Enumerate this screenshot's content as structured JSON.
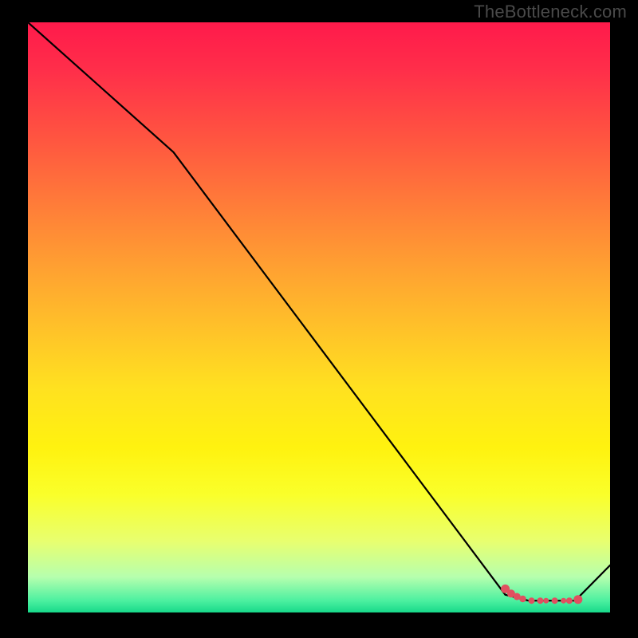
{
  "watermark": "TheBottleneck.com",
  "chart_data": {
    "type": "line",
    "title": "",
    "xlabel": "",
    "ylabel": "",
    "xlim": [
      0,
      100
    ],
    "ylim": [
      0,
      100
    ],
    "series": [
      {
        "name": "curve",
        "color": "#000000",
        "points": [
          {
            "x": 0,
            "y": 100
          },
          {
            "x": 25,
            "y": 78
          },
          {
            "x": 82,
            "y": 3
          },
          {
            "x": 86,
            "y": 2
          },
          {
            "x": 94,
            "y": 2
          },
          {
            "x": 100,
            "y": 8
          }
        ]
      }
    ],
    "markers": [
      {
        "x": 82.0,
        "y": 4.0,
        "r": 5.5
      },
      {
        "x": 83.0,
        "y": 3.2,
        "r": 5.0
      },
      {
        "x": 84.0,
        "y": 2.7,
        "r": 4.5
      },
      {
        "x": 85.0,
        "y": 2.3,
        "r": 4.2
      },
      {
        "x": 86.5,
        "y": 2.0,
        "r": 4.0
      },
      {
        "x": 88.0,
        "y": 2.0,
        "r": 4.0
      },
      {
        "x": 89.0,
        "y": 2.0,
        "r": 3.5
      },
      {
        "x": 90.5,
        "y": 2.0,
        "r": 4.0
      },
      {
        "x": 92.0,
        "y": 2.0,
        "r": 3.5
      },
      {
        "x": 93.0,
        "y": 2.0,
        "r": 4.0
      },
      {
        "x": 94.5,
        "y": 2.2,
        "r": 5.5
      }
    ],
    "marker_color": "#e05060",
    "gradient_stops": [
      {
        "pos": 0,
        "color": "#ff1a4b"
      },
      {
        "pos": 50,
        "color": "#ffd420"
      },
      {
        "pos": 100,
        "color": "#17d98a"
      }
    ]
  }
}
